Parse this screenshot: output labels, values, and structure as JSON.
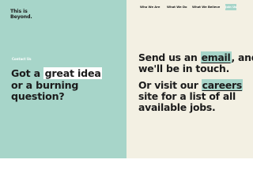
{
  "brand": {
    "line1": "This is",
    "line2": "Beyond."
  },
  "nav": {
    "items": [
      "Who We Are",
      "What We Do",
      "What We Believe"
    ],
    "cta": "Join Us"
  },
  "contact": {
    "eyebrow": "Contact Us",
    "headline_line1_prefix": "Got a ",
    "headline_line1_highlight": "great idea",
    "headline_line2": "or a burning",
    "headline_line3": "question?",
    "email_prefix": "Send us an ",
    "email_link": "email",
    "email_suffix": ", and",
    "email_line2": "we'll be in touch.",
    "careers_prefix": "Or visit our ",
    "careers_link": "careers",
    "careers_line2": "site for a list of all",
    "careers_line3": "available jobs."
  },
  "colors": {
    "mint": "#a7d5c9",
    "cream": "#f3f0e3",
    "text": "#1b1b1b",
    "white": "#ffffff"
  }
}
